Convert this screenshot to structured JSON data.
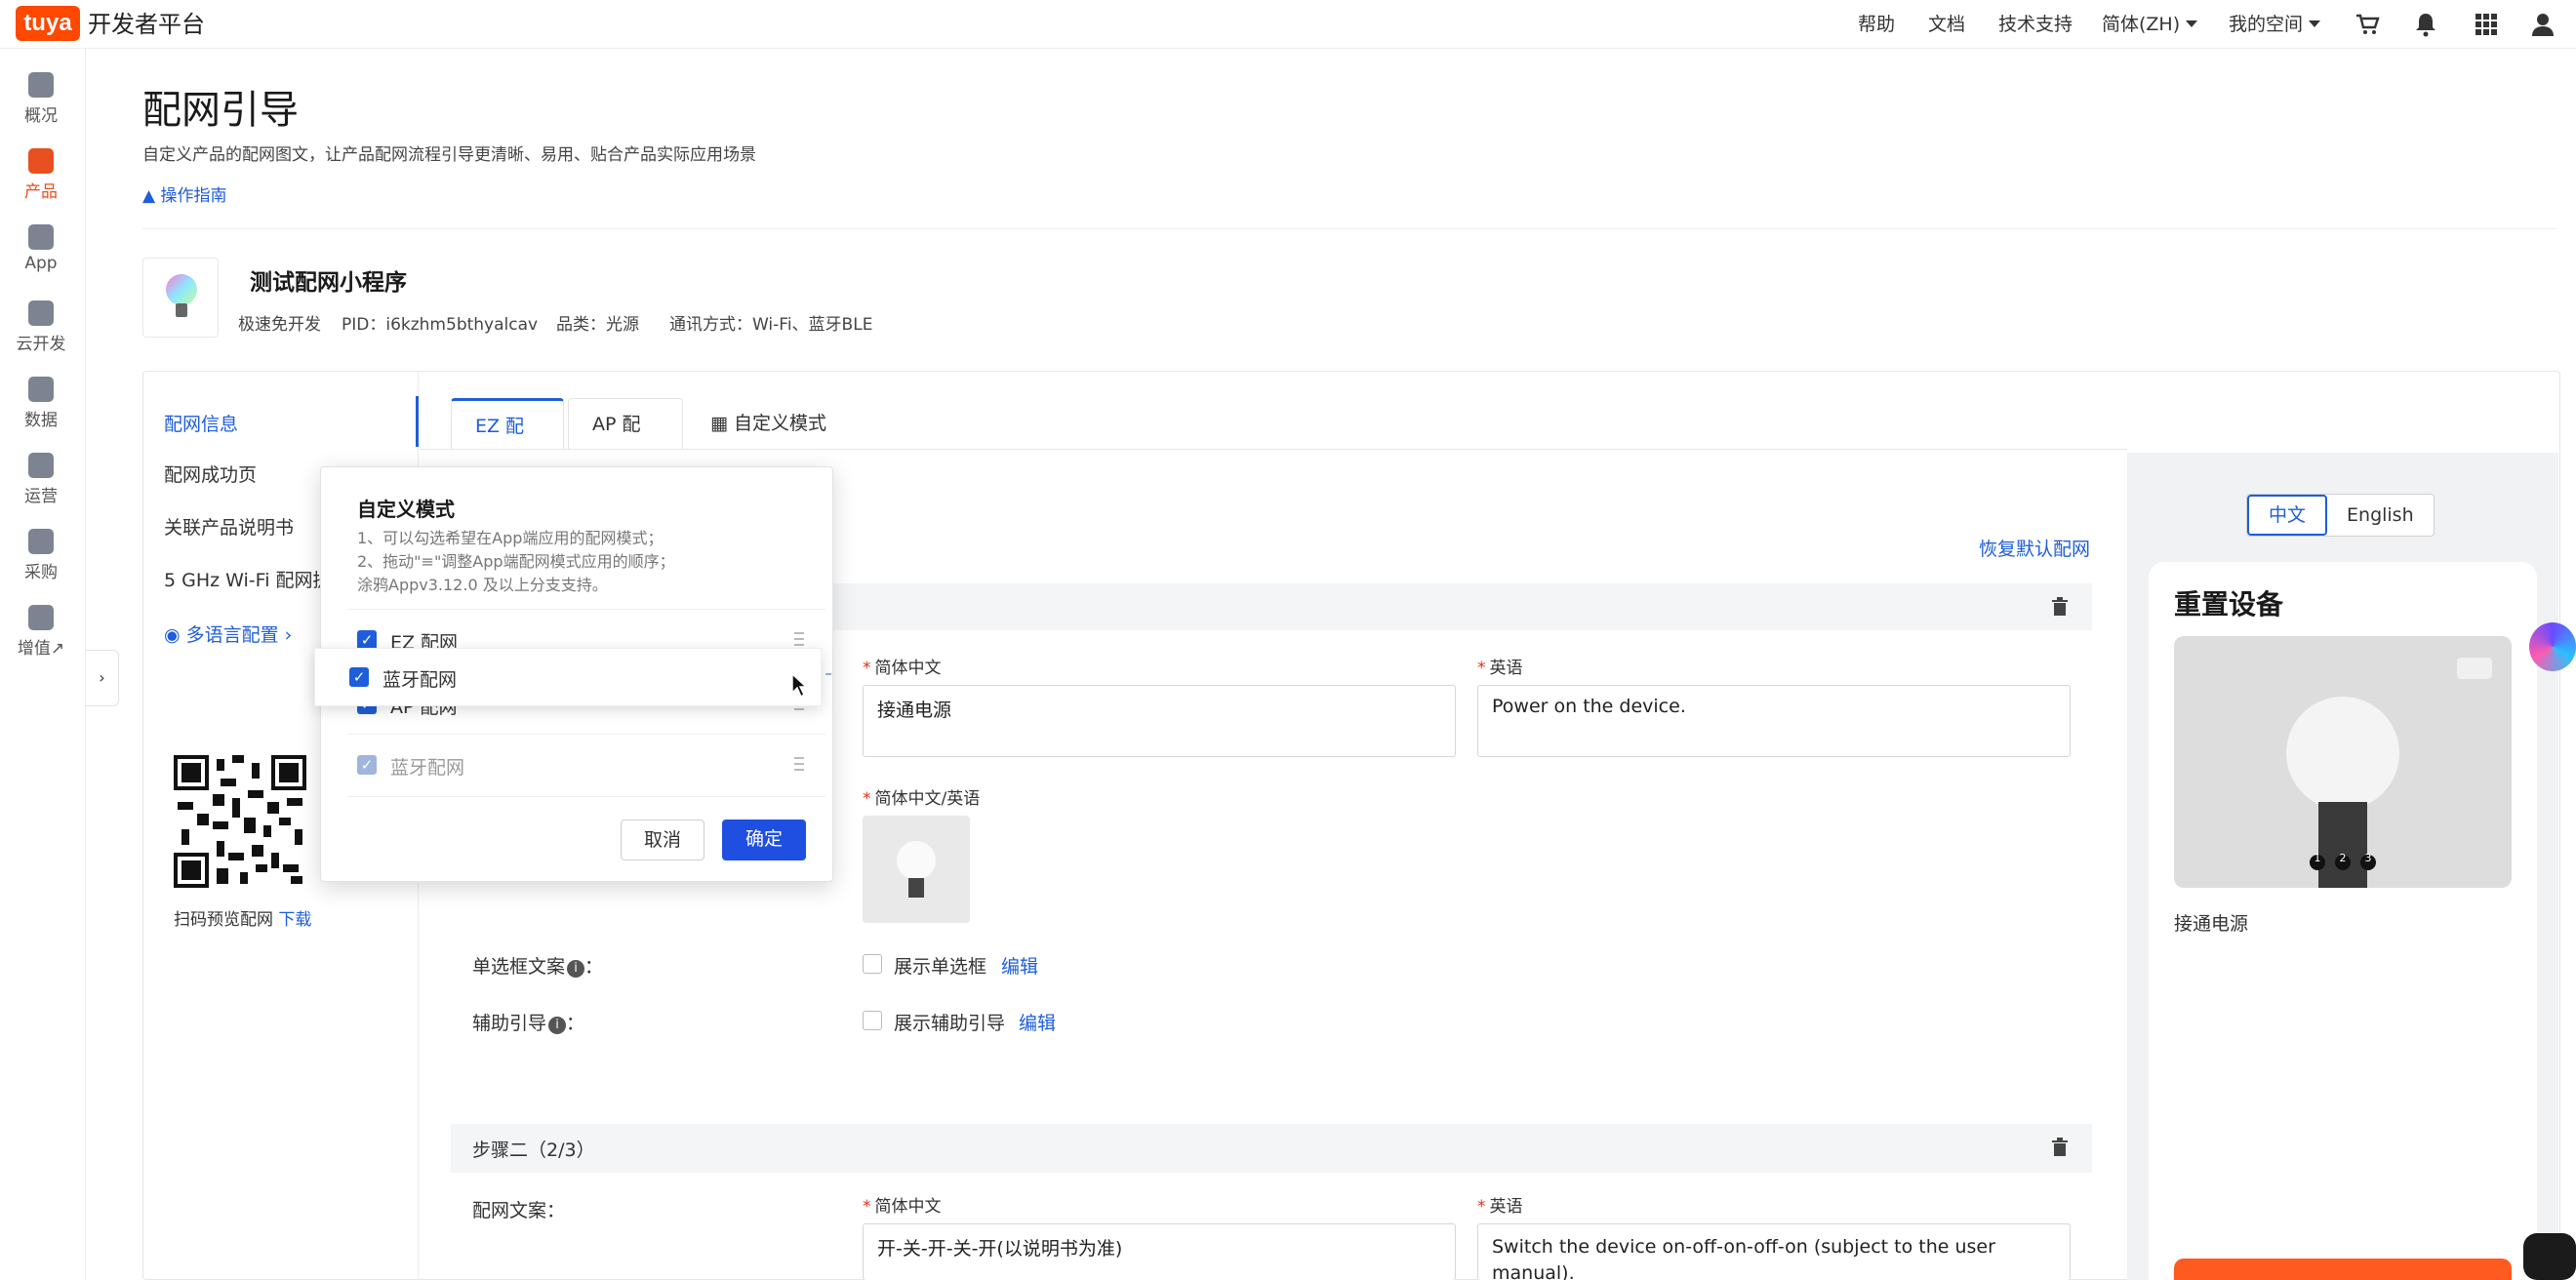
{
  "topbar": {
    "logo": "tuya",
    "brand": "开发者平台",
    "nav": [
      "帮助",
      "文档",
      "技术支持"
    ],
    "lang": "简体(ZH)",
    "space": "我的空间",
    "icons": [
      "cart-icon",
      "bell-icon",
      "apps-grid-icon",
      "user-icon"
    ]
  },
  "leftnav": {
    "items": [
      {
        "label": "概况",
        "icon": "home-icon"
      },
      {
        "label": "产品",
        "icon": "product-icon",
        "active": true
      },
      {
        "label": "App",
        "icon": "phone-icon"
      },
      {
        "label": "云开发",
        "icon": "cloud-icon"
      },
      {
        "label": "数据",
        "icon": "chart-icon"
      },
      {
        "label": "运营",
        "icon": "bookmark-icon"
      },
      {
        "label": "采购",
        "icon": "bag-icon"
      },
      {
        "label": "增值",
        "icon": "diamond-icon"
      }
    ],
    "external_mark": "↗",
    "collapse": "›"
  },
  "page": {
    "title": "配网引导",
    "desc": "自定义产品的配网图文，让产品配网流程引导更清晰、易用、贴合产品实际应用场景",
    "guide_link": "操作指南"
  },
  "product": {
    "name": "测试配网小程序",
    "dev_mode": "极速免开发",
    "pid": "PID：i6kzhm5bthyalcav",
    "category": "品类：光源",
    "comm": "通讯方式：Wi-Fi、蓝牙BLE"
  },
  "side_menu": {
    "items": [
      "配网信息",
      "配网成功页",
      "关联产品说明书",
      "5 GHz Wi-Fi 配网提"
    ],
    "multi_lang": "多语言配置",
    "qr_caption": "扫码预览配网",
    "qr_download": "下载"
  },
  "tabs": [
    "EZ 配网",
    "AP 配网",
    "自定义模式"
  ],
  "editor": {
    "restore": "恢复默认配网",
    "lang_cn_label": "简体中文",
    "lang_en_label": "英语",
    "image_label": "简体中文/英语",
    "step1_cn": "接通电源",
    "step1_en": "Power on the device.",
    "radio_label": "单选框文案",
    "radio_check": "展示单选框",
    "assist_label": "辅助引导",
    "assist_check": "展示辅助引导",
    "edit": "编辑",
    "colon": "：",
    "info": "i",
    "step2_title": "步骤二（2/3）",
    "step2_label": "配网文案：",
    "step2_cn": "开-关-开-关-开(以说明书为准)",
    "step2_en": "Switch the device on-off-on-off-on (subject to the user manual)."
  },
  "preview": {
    "lang_cn": "中文",
    "lang_en": "English",
    "title": "重置设备",
    "caption": "接通电源",
    "dots": [
      "1",
      "2",
      "3"
    ]
  },
  "popover": {
    "title": "自定义模式",
    "hint1": "1、可以勾选希望在App端应用的配网模式；",
    "hint2": "2、拖动\"≡\"调整App端配网模式应用的顺序；",
    "hint3": "涂鸦Appv3.12.0 及以上分支支持。",
    "items": [
      "EZ 配网",
      "AP 配网",
      "蓝牙配网"
    ],
    "dragging": "蓝牙配网",
    "cancel": "取消",
    "ok": "确定"
  },
  "colors": {
    "accent": "#1e5ddb",
    "brand": "#ff4800",
    "primary_btn": "#1e4fe0",
    "nav_active": "#e8501f"
  }
}
